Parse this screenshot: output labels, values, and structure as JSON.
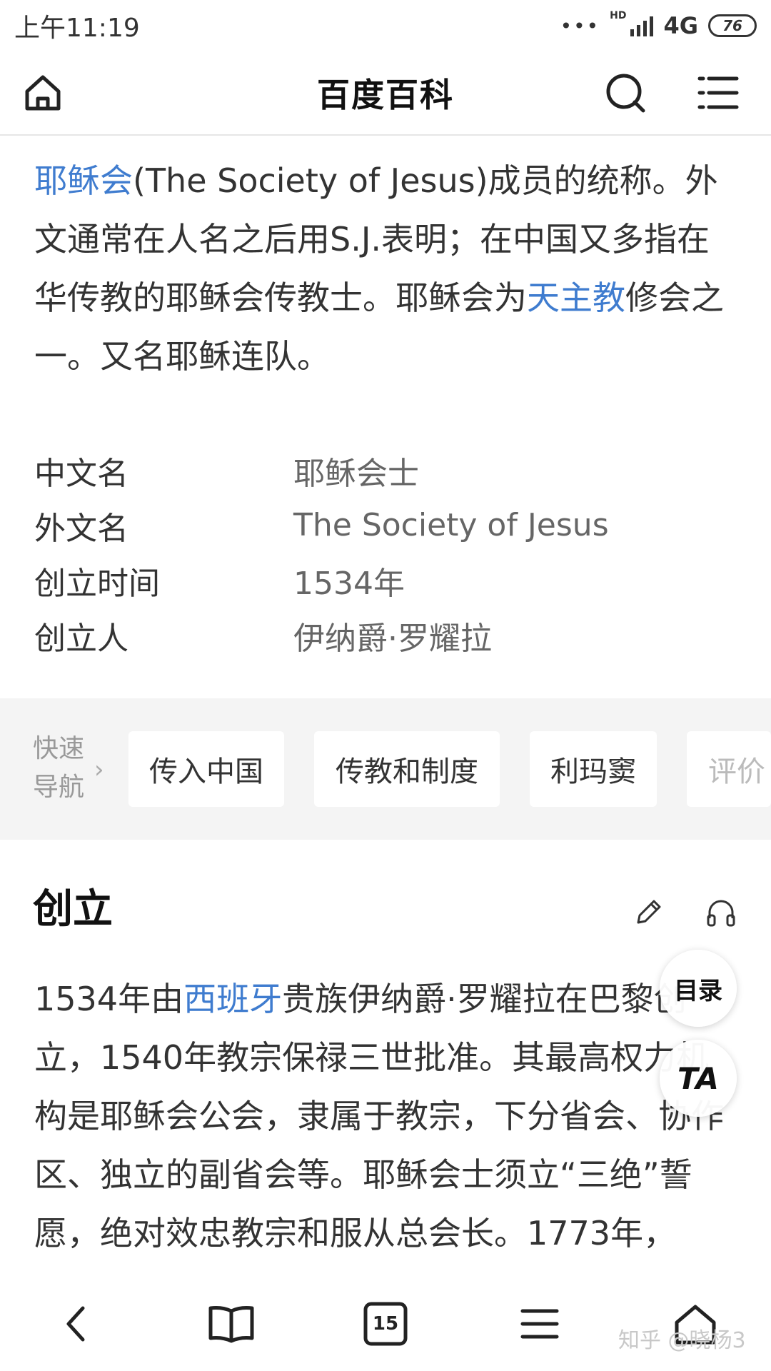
{
  "status_bar": {
    "time": "上午11:19",
    "dots": "•••",
    "hd": "HD",
    "network": "4G",
    "battery": "76"
  },
  "header": {
    "title": "百度百科",
    "icons": [
      "home-icon",
      "search-icon",
      "menu-icon"
    ]
  },
  "intro": {
    "link1": "耶稣会",
    "text1": "(The Society of Jesus)成员的统称。外文通常在人名之后用S.J.表明；在中国又多指在华传教的耶稣会传教士。耶稣会为",
    "link2": "天主教",
    "text2": "修会之一。又名耶稣连队。"
  },
  "info": [
    {
      "label": "中文名",
      "value": "耶稣会士"
    },
    {
      "label": "外文名",
      "value": "The Society of Jesus"
    },
    {
      "label": "创立时间",
      "value": "1534年"
    },
    {
      "label": "创立人",
      "value": "伊纳爵·罗耀拉"
    }
  ],
  "quick_nav": {
    "label": "快速导航",
    "chevron": "›",
    "items": [
      "传入中国",
      "传教和制度",
      "利玛窦",
      "评价"
    ]
  },
  "section": {
    "title": "创立",
    "icons": [
      "edit-icon",
      "headphones-icon"
    ],
    "text_a": "1534年由",
    "link": "西班牙",
    "text_b": "贵族伊纳爵·罗耀拉在巴黎创立，1540年教宗保禄三世批准。其最高权力机构是耶稣会公会，隶属于教宗，下分省会、协作区、独立的副省会等。耶稣会士须立“三绝”誓愿，绝对效忠教宗和服从总会长。1773年，"
  },
  "fabs": {
    "toc": "目录",
    "ta": "TA"
  },
  "bottom_bar": {
    "icons": [
      "back-icon",
      "book-icon",
      "tabs-icon",
      "menu-icon",
      "home-icon"
    ],
    "tabs_count": "15"
  },
  "watermark": "知乎 @晓杨3",
  "colors": {
    "link": "#3f7ccf",
    "quicknav_bg": "#f4f4f4"
  }
}
